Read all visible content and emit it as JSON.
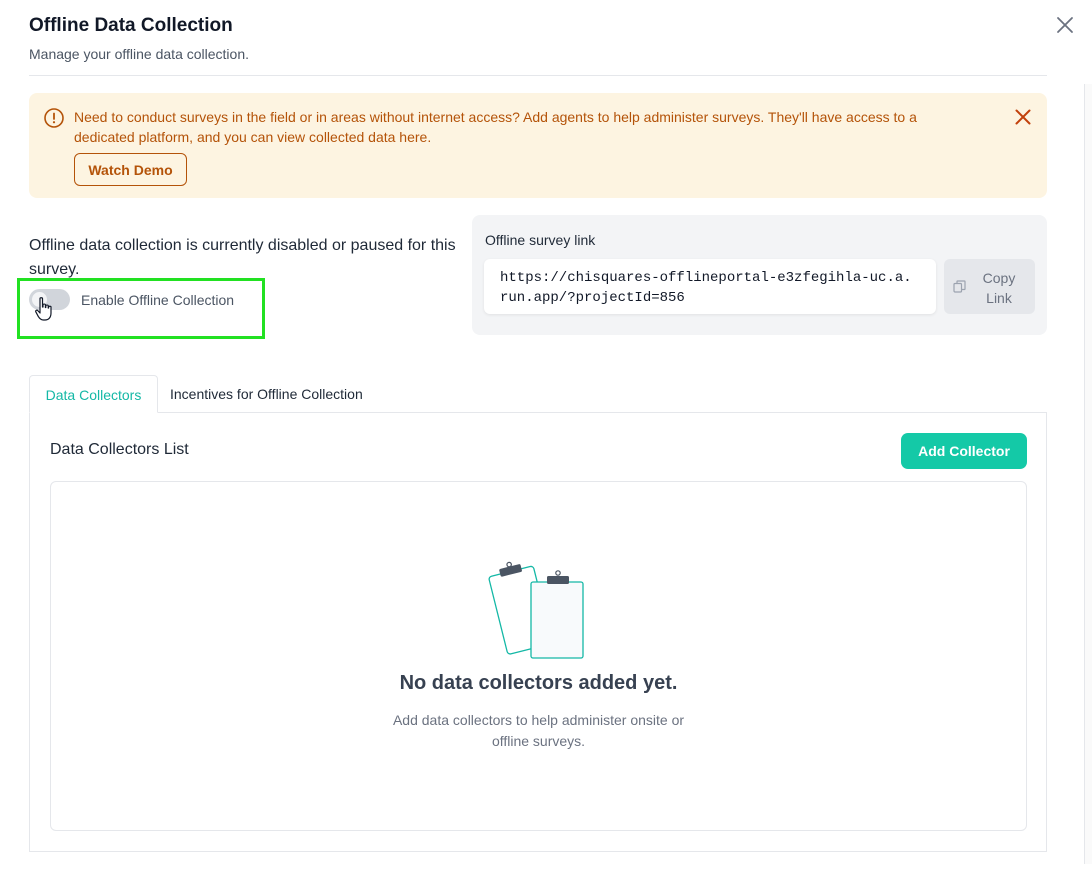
{
  "header": {
    "title": "Offline Data Collection",
    "subtitle": "Manage your offline data collection."
  },
  "alert": {
    "message": "Need to conduct surveys in the field or in areas without internet access? Add agents to help administer surveys. They'll have access to a dedicated platform, and you can view collected data here.",
    "watch_demo_label": "Watch Demo",
    "icon": "warning-circle-icon"
  },
  "offline_status": {
    "message": "Offline data collection is currently disabled or paused for this survey.",
    "toggle_label": "Enable Offline Collection",
    "enabled": false
  },
  "survey_link": {
    "label": "Offline survey link",
    "url": "https://chisquares-offlineportal-e3zfegihla-uc.a.run.app/?projectId=856",
    "copy_label": "Copy Link"
  },
  "tabs": [
    {
      "label": "Data Collectors",
      "active": true
    },
    {
      "label": "Incentives for Offline Collection",
      "active": false
    }
  ],
  "collectors": {
    "title": "Data Collectors List",
    "add_label": "Add Collector",
    "empty_title": "No data collectors added yet.",
    "empty_description": "Add data collectors to help administer onsite or offline surveys."
  },
  "colors": {
    "accent": "#14c9a7",
    "tab_active": "#14b8a6",
    "alert_bg": "#fdf4e1",
    "alert_text": "#b45309",
    "highlight": "#22e122"
  }
}
